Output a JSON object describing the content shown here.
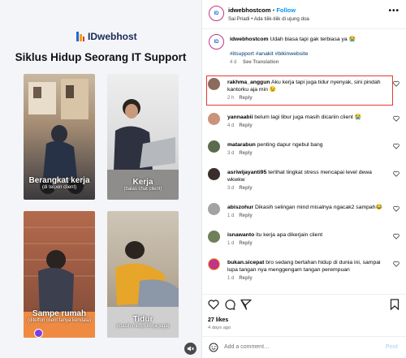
{
  "post": {
    "brand": "IDwebhost",
    "headline": "Siklus Hidup Seorang IT Support",
    "panels": [
      {
        "title": "Berangkat kerja",
        "subtitle": "(di telpon client)"
      },
      {
        "title": "Kerja",
        "subtitle": "(balas chat client)"
      },
      {
        "title": "Sampe rumah",
        "subtitle": "(ditelfon client tanya kendala)"
      },
      {
        "title": "Tidur",
        "subtitle": "(masih mimpi kerja juga)"
      }
    ]
  },
  "header": {
    "username": "idwebhostcom",
    "separator": "•",
    "follow": "Follow",
    "location": "Sai Priadi • Ada tiiik-tiiik di ujung doa"
  },
  "caption": {
    "username": "idwebhostcom",
    "text": "Udah biasa tapi gak terbiasa ya 😭",
    "hashtags": "#itsupport #anakit #bikinwebsite",
    "time": "4 d",
    "translate": "See Translation"
  },
  "comments": [
    {
      "user": "rakhma_anggun",
      "text": "Aku kerja tapi juga tidur nyenyak, sini pindah kantorku aja min 😉",
      "time": "2 h",
      "reply": "Reply"
    },
    {
      "user": "yannaabii",
      "text": "belum lagi libur juga masih dicariin client 😭",
      "time": "4 d",
      "reply": "Reply"
    },
    {
      "user": "matarabun",
      "text": "penting dapur ngebul bang",
      "time": "3 d",
      "reply": "Reply"
    },
    {
      "user": "asriwijayanti95",
      "text": "terlihat tingkat stress mencapai level dewa wkwkw",
      "time": "3 d",
      "reply": "Reply"
    },
    {
      "user": "abiszohur",
      "text": "Dikasih selingan mind misalnya ngacak2 sampah😂",
      "time": "1 d",
      "reply": "Reply"
    },
    {
      "user": "isnawanto",
      "text": "itu kerja apa dikerjain client",
      "time": "1 d",
      "reply": "Reply"
    },
    {
      "user": "bukan.sicepat",
      "text": "bro sedang bertahan hidup di dunia ini, sampai lupa tangan nya menggengam tangan perempuan",
      "time": "1 d",
      "reply": "Reply"
    }
  ],
  "footer": {
    "likes": "27 likes",
    "ago": "4 days ago",
    "add_placeholder": "Add a comment…",
    "post_label": "Post"
  },
  "colors": {
    "accent": "#0095f6",
    "highlight": "#e53935",
    "brand": "#1a2a55"
  }
}
